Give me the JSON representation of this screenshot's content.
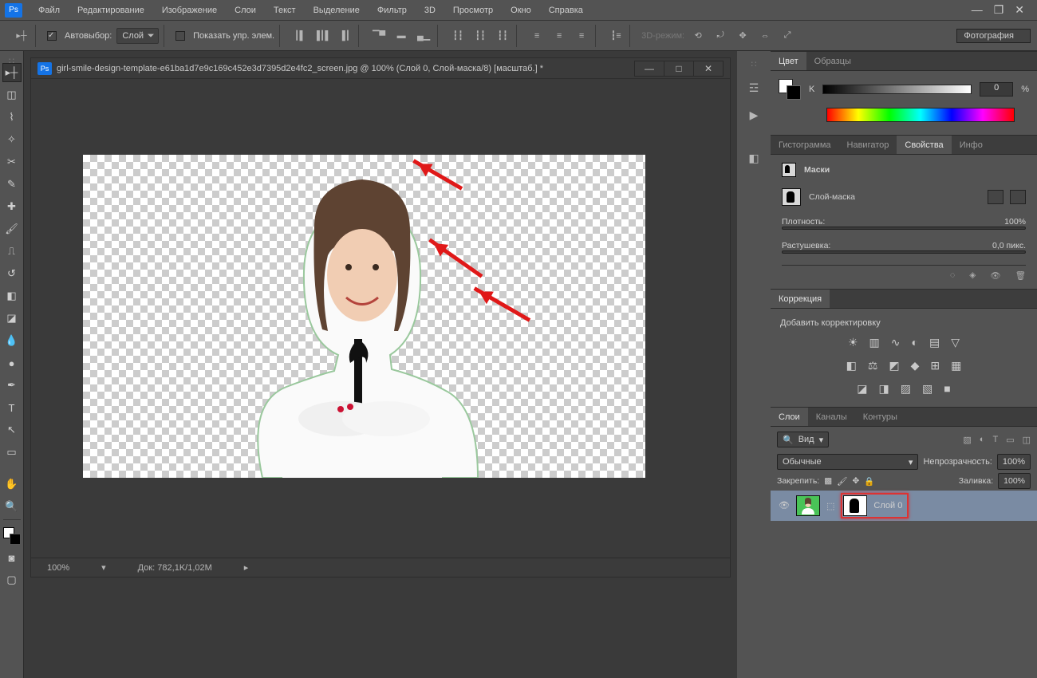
{
  "app": {
    "logo": "Ps"
  },
  "menu": [
    "Файл",
    "Редактирование",
    "Изображение",
    "Слои",
    "Текст",
    "Выделение",
    "Фильтр",
    "3D",
    "Просмотр",
    "Окно",
    "Справка"
  ],
  "options": {
    "autoselect_label": "Автовыбор:",
    "autoselect_value": "Слой",
    "show_controls": "Показать упр. элем.",
    "mode3d_label": "3D-режим:"
  },
  "workspace": "Фотография",
  "document": {
    "prefix": "Ps",
    "title": "girl-smile-design-template-e61ba1d7e9c169c452e3d7395d2e4fc2_screen.jpg @ 100% (Слой 0, Слой-маска/8) [масштаб.] *",
    "zoom": "100%",
    "size": "Док: 782,1K/1,02M"
  },
  "panels": {
    "color": {
      "tab1": "Цвет",
      "tab2": "Образцы",
      "channel": "K",
      "value": "0",
      "unit": "%"
    },
    "info_tabs": {
      "t1": "Гистограмма",
      "t2": "Навигатор",
      "t3": "Свойства",
      "t4": "Инфо"
    },
    "properties": {
      "title": "Маски",
      "mask_label": "Слой-маска",
      "density_label": "Плотность:",
      "density_value": "100%",
      "feather_label": "Растушевка:",
      "feather_value": "0,0 пикс."
    },
    "adjustments": {
      "tab": "Коррекция",
      "add": "Добавить корректировку"
    },
    "layers": {
      "t1": "Слои",
      "t2": "Каналы",
      "t3": "Контуры",
      "kind": "Вид",
      "blend": "Обычные",
      "opacity_label": "Непрозрачность:",
      "opacity_value": "100%",
      "lock_label": "Закрепить:",
      "fill_label": "Заливка:",
      "fill_value": "100%",
      "layer0": "Слой 0"
    }
  }
}
